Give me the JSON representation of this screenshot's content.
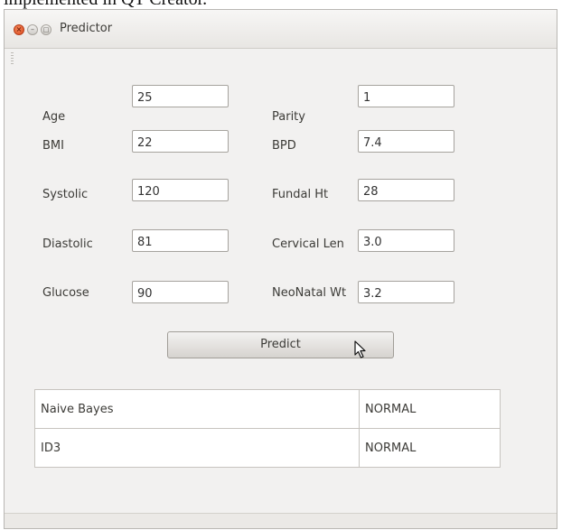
{
  "caption": "implemented in QT Creator.",
  "window": {
    "title": "Predictor"
  },
  "form": {
    "left": [
      {
        "label": "Age",
        "value": "25"
      },
      {
        "label": "BMI",
        "value": "22"
      },
      {
        "label": "Systolic",
        "value": "120"
      },
      {
        "label": "Diastolic",
        "value": "81"
      },
      {
        "label": "Glucose",
        "value": "90"
      }
    ],
    "right": [
      {
        "label": "Parity",
        "value": "1"
      },
      {
        "label": "BPD",
        "value": "7.4"
      },
      {
        "label": "Fundal Ht",
        "value": "28"
      },
      {
        "label": "Cervical Len",
        "value": "3.0"
      },
      {
        "label": "NeoNatal Wt",
        "value": "3.2"
      }
    ]
  },
  "predict_label": "Predict",
  "results": [
    {
      "name": "Naive Bayes",
      "value": "NORMAL"
    },
    {
      "name": "ID3",
      "value": "NORMAL"
    }
  ],
  "icons": {
    "close": "close-icon",
    "minimize": "minimize-icon",
    "maximize": "maximize-icon",
    "cursor": "mouse-pointer-icon"
  },
  "colors": {
    "close_button": "#d9471c",
    "window_bg": "#f2f1f0",
    "text": "#3c3b37"
  }
}
